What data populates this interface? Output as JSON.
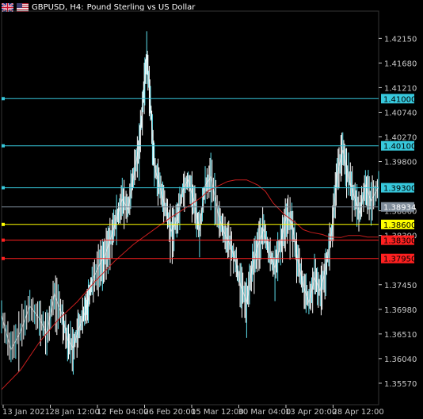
{
  "title": {
    "symbol_text": "GBPUSD, H4:",
    "description": "Pound Sterling vs US Dollar",
    "flag_left_icon": "uk-flag-icon",
    "flag_right_icon": "us-flag-icon"
  },
  "colors": {
    "background": "#000000",
    "bars": "#ffffff",
    "ma": "#c81e1e",
    "level_cyan": "#37c8dc",
    "level_yellow": "#ffff00",
    "level_red": "#ff2020",
    "bid_line": "#7f8c99",
    "axis": "#c8c8c8"
  },
  "chart_data": {
    "type": "line",
    "title": "GBPUSD, H4:  Pound Sterling vs US Dollar",
    "ylim": [
      1.3516,
      1.4267
    ],
    "y_ticks": [
      "1.42150",
      "1.41680",
      "1.41210",
      "1.40740",
      "1.40270",
      "1.39800",
      "1.38860",
      "1.38390",
      "1.37450",
      "1.36980",
      "1.36510",
      "1.36040",
      "1.35570"
    ],
    "x_labels": [
      "13 Jan 2021",
      "28 Jan 12:00",
      "12 Feb 04:00",
      "26 Feb 20:00",
      "15 Mar 12:00",
      "30 Mar 04:00",
      "13 Apr 20:00",
      "28 Apr 12:00"
    ],
    "series": [
      {
        "style": "price",
        "x": [
          0,
          0.025,
          0.05,
          0.075,
          0.1,
          0.12,
          0.14,
          0.16,
          0.175,
          0.19,
          0.205,
          0.22,
          0.23,
          0.24,
          0.26,
          0.275,
          0.29,
          0.305,
          0.32,
          0.335,
          0.35,
          0.365,
          0.375,
          0.385,
          0.395,
          0.405,
          0.42,
          0.435,
          0.45,
          0.465,
          0.48,
          0.495,
          0.51,
          0.525,
          0.54,
          0.555,
          0.575,
          0.59,
          0.605,
          0.62,
          0.635,
          0.65,
          0.665,
          0.68,
          0.695,
          0.71,
          0.725,
          0.74,
          0.755,
          0.77,
          0.785,
          0.8,
          0.815,
          0.83,
          0.845,
          0.86,
          0.875,
          0.89,
          0.905,
          0.92,
          0.935,
          0.95,
          0.965,
          0.98,
          1
        ],
        "values": [
          1.3686,
          1.3621,
          1.3655,
          1.3704,
          1.3681,
          1.3652,
          1.3727,
          1.3688,
          1.364,
          1.3625,
          1.3662,
          1.369,
          1.3718,
          1.3752,
          1.3784,
          1.3802,
          1.3835,
          1.3871,
          1.3908,
          1.3889,
          1.3952,
          1.401,
          1.4095,
          1.4183,
          1.4091,
          1.3973,
          1.3931,
          1.3889,
          1.3847,
          1.3868,
          1.3924,
          1.3945,
          1.3905,
          1.3848,
          1.3934,
          1.3951,
          1.3878,
          1.3845,
          1.3822,
          1.3792,
          1.3741,
          1.3712,
          1.3778,
          1.3821,
          1.3851,
          1.3803,
          1.3778,
          1.3825,
          1.3874,
          1.3862,
          1.3793,
          1.3745,
          1.3711,
          1.3758,
          1.3734,
          1.3778,
          1.3843,
          1.3955,
          1.4002,
          1.3951,
          1.3914,
          1.3882,
          1.3935,
          1.3905,
          1.3932
        ]
      },
      {
        "style": "moving_average",
        "x": [
          0,
          0.05,
          0.1,
          0.15,
          0.2,
          0.25,
          0.3,
          0.35,
          0.4,
          0.45,
          0.5,
          0.53,
          0.55,
          0.57,
          0.6,
          0.62,
          0.65,
          0.68,
          0.7,
          0.72,
          0.75,
          0.78,
          0.8,
          0.82,
          0.85,
          0.87,
          0.9,
          0.92,
          0.95,
          0.97,
          1
        ],
        "values": [
          1.3545,
          1.3582,
          1.3635,
          1.3678,
          1.3712,
          1.3753,
          1.379,
          1.3822,
          1.3848,
          1.3874,
          1.3897,
          1.3912,
          1.3925,
          1.3932,
          1.3942,
          1.3945,
          1.3945,
          1.3935,
          1.3923,
          1.3901,
          1.3879,
          1.3863,
          1.385,
          1.3845,
          1.3841,
          1.3836,
          1.3835,
          1.3839,
          1.3839,
          1.3836,
          1.3836
        ]
      }
    ],
    "levels": [
      {
        "value": 1.41,
        "label": "1.41000",
        "kind": "cyan"
      },
      {
        "value": 1.401,
        "label": "1.40100",
        "kind": "cyan"
      },
      {
        "value": 1.393,
        "label": "1.39300",
        "kind": "cyan"
      },
      {
        "value": 1.386,
        "label": "1.38600",
        "kind": "yellow"
      },
      {
        "value": 1.383,
        "label": "1.38300",
        "kind": "red"
      },
      {
        "value": 1.3795,
        "label": "1.37950",
        "kind": "red"
      }
    ],
    "bid": {
      "value": 1.38934,
      "label": "1.38934"
    }
  }
}
